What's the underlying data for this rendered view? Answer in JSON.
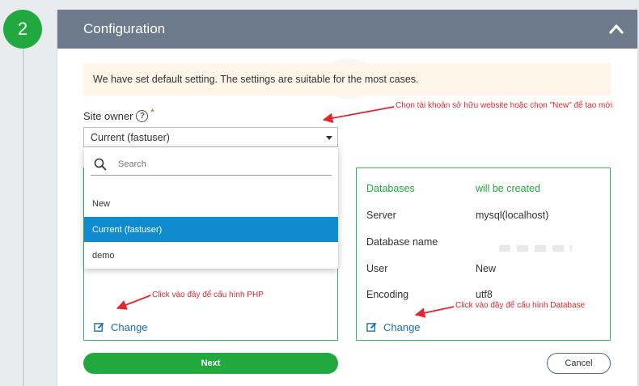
{
  "step": {
    "number": "2"
  },
  "panel": {
    "title": "Configuration"
  },
  "notice": {
    "text": "We have set default setting. The settings are suitable for the most cases."
  },
  "site_owner": {
    "label": "Site owner",
    "help": "?",
    "required": "*",
    "selected": "Current (fastuser)"
  },
  "dropdown": {
    "search_placeholder": "Search",
    "options": [
      "New",
      "Current (fastuser)",
      "demo"
    ],
    "selected_index": 1
  },
  "database": {
    "head_label": "Databases",
    "head_value": "will be created",
    "rows": [
      {
        "label": "Server",
        "value": "mysql(localhost)"
      },
      {
        "label": "Database name",
        "value": ""
      },
      {
        "label": "User",
        "value": "New"
      },
      {
        "label": "Encoding",
        "value": "utf8"
      }
    ]
  },
  "php_card": {
    "change_label": "Change"
  },
  "db_card": {
    "change_label": "Change"
  },
  "buttons": {
    "next": "Next",
    "cancel": "Cancel"
  },
  "annotations": {
    "owner": "Chọn tài khoản sở hữu website hoặc chọn \"New\" để tạo mới",
    "php": "Click vào đây để cấu hình PHP",
    "db": "Click vào đây để cấu hình Database"
  },
  "colors": {
    "green": "#21a93f",
    "header": "#6c7a8b",
    "selected": "#0f8ccf",
    "link": "#1b6fb5",
    "annotation": "#e0282e"
  }
}
